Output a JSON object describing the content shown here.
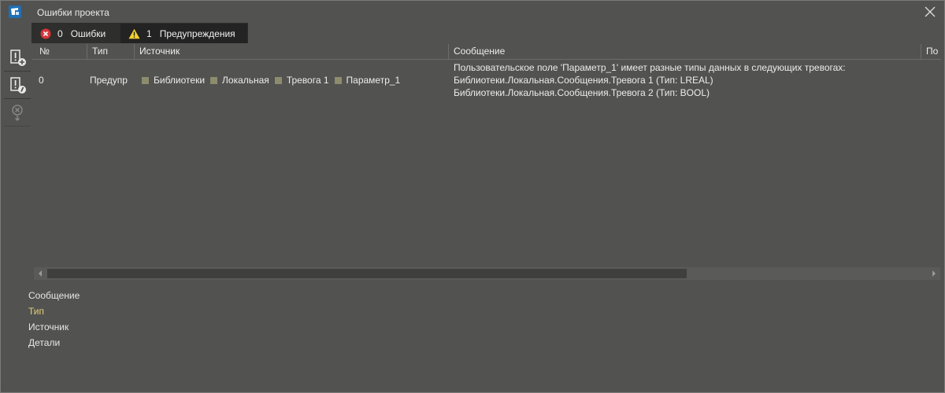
{
  "window": {
    "title": "Ошибки проекта"
  },
  "tabs": {
    "errors": {
      "count": "0",
      "label": "Ошибки"
    },
    "warnings": {
      "count": "1",
      "label": "Предупреждения"
    }
  },
  "toolbar": {
    "icons": [
      "add-warning-icon",
      "warning-info-icon",
      "clear-errors-icon"
    ]
  },
  "table": {
    "headers": {
      "num": "№",
      "type": "Тип",
      "source": "Источник",
      "message": "Сообщение",
      "extra": "По"
    },
    "rows": [
      {
        "num": "0",
        "type": "Предупр",
        "source": [
          "Библиотеки",
          "Локальная",
          "Тревога 1",
          "Параметр_1"
        ],
        "message": [
          "Пользовательское поле 'Параметр_1' имеет разные типы данных в следующих тревогах:",
          "Библиотеки.Локальная.Сообщения.Тревога 1 (Тип: LREAL)",
          "Библиотеки.Локальная.Сообщения.Тревога 2 (Тип: BOOL)"
        ]
      }
    ]
  },
  "details": {
    "message": "Сообщение",
    "type": "Тип",
    "source": "Источник",
    "details": "Детали"
  },
  "colors": {
    "background": "#525250",
    "error": "#d8363a",
    "warning": "#f2d22c",
    "source_marker": "#8c8c6e",
    "accent_text": "#e3cf73"
  }
}
